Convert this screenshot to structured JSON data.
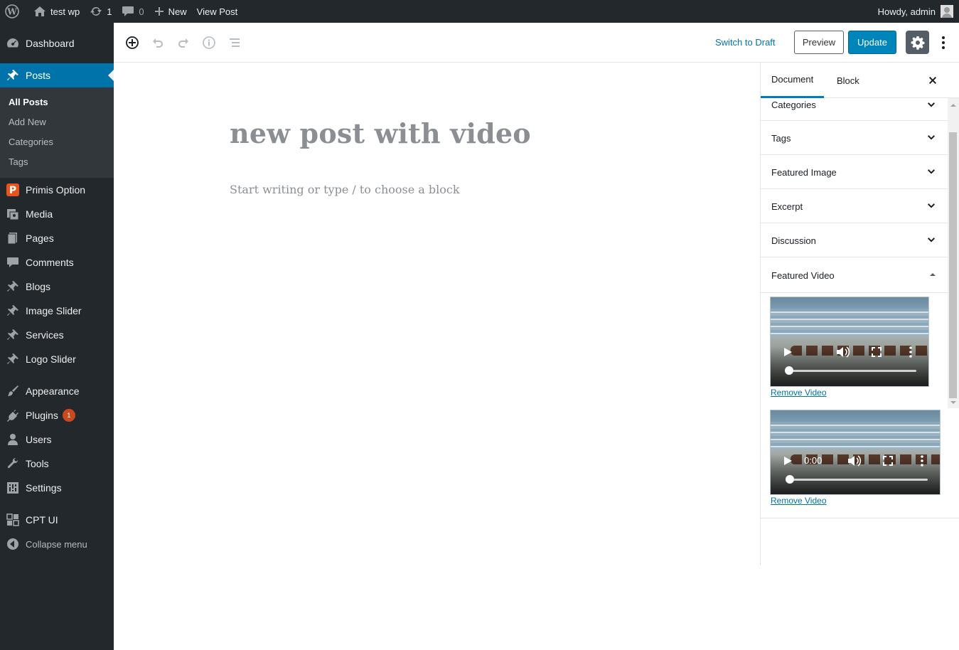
{
  "admin_bar": {
    "site_name": "test wp",
    "updates_count": "1",
    "comments_count": "0",
    "new_label": "New",
    "view_post_label": "View Post",
    "howdy": "Howdy, admin"
  },
  "sidebar": {
    "dashboard": "Dashboard",
    "posts": "Posts",
    "posts_sub": [
      "All Posts",
      "Add New",
      "Categories",
      "Tags"
    ],
    "items": [
      "Primis Option",
      "Media",
      "Pages",
      "Comments",
      "Blogs",
      "Image Slider",
      "Services",
      "Logo Slider",
      "Appearance",
      "Plugins",
      "Users",
      "Tools",
      "Settings",
      "CPT UI"
    ],
    "plugins_badge": "1",
    "collapse": "Collapse menu"
  },
  "toolbar": {
    "switch_to_draft": "Switch to Draft",
    "preview": "Preview",
    "update": "Update"
  },
  "editor": {
    "title": "new post with video",
    "placeholder": "Start writing or type / to choose a block"
  },
  "settings_panel": {
    "tabs": [
      "Document",
      "Block"
    ],
    "sections": [
      "Categories",
      "Tags",
      "Featured Image",
      "Excerpt",
      "Discussion",
      "Featured Video"
    ],
    "videos": [
      {
        "remove_label": "Remove Video"
      },
      {
        "time": "0:00",
        "remove_label": "Remove Video"
      }
    ]
  },
  "colors": {
    "admin_bg": "#23282d",
    "accent": "#0073aa",
    "update_button": "#0085ba",
    "badge": "#ca4a1f"
  }
}
